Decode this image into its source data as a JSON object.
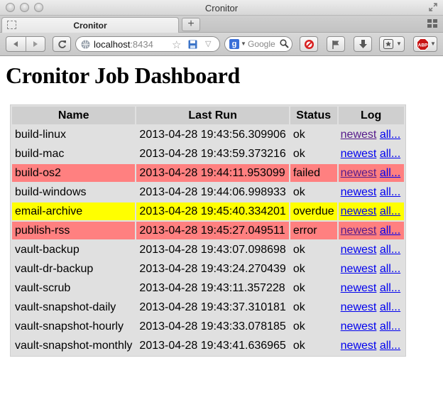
{
  "window": {
    "title": "Cronitor"
  },
  "tab": {
    "title": "Cronitor"
  },
  "toolbar": {
    "url_host": "localhost",
    "url_port": ":8434",
    "search_placeholder": "Google"
  },
  "page": {
    "title": "Cronitor Job Dashboard"
  },
  "table": {
    "headers": {
      "name": "Name",
      "last_run": "Last Run",
      "status": "Status",
      "log": "Log"
    },
    "rows": [
      {
        "name": "build-linux",
        "last_run": "2013-04-28 19:43:56.309906",
        "status": "ok",
        "newest": "newest",
        "all": "all..."
      },
      {
        "name": "build-mac",
        "last_run": "2013-04-28 19:43:59.373216",
        "status": "ok",
        "newest": "newest",
        "all": "all..."
      },
      {
        "name": "build-os2",
        "last_run": "2013-04-28 19:44:11.953099",
        "status": "failed",
        "newest": "newest",
        "all": "all..."
      },
      {
        "name": "build-windows",
        "last_run": "2013-04-28 19:44:06.998933",
        "status": "ok",
        "newest": "newest",
        "all": "all..."
      },
      {
        "name": "email-archive",
        "last_run": "2013-04-28 19:45:40.334201",
        "status": "overdue",
        "newest": "newest",
        "all": "all..."
      },
      {
        "name": "publish-rss",
        "last_run": "2013-04-28 19:45:27.049511",
        "status": "error",
        "newest": "newest",
        "all": "all..."
      },
      {
        "name": "vault-backup",
        "last_run": "2013-04-28 19:43:07.098698",
        "status": "ok",
        "newest": "newest",
        "all": "all..."
      },
      {
        "name": "vault-dr-backup",
        "last_run": "2013-04-28 19:43:24.270439",
        "status": "ok",
        "newest": "newest",
        "all": "all..."
      },
      {
        "name": "vault-scrub",
        "last_run": "2013-04-28 19:43:11.357228",
        "status": "ok",
        "newest": "newest",
        "all": "all..."
      },
      {
        "name": "vault-snapshot-daily",
        "last_run": "2013-04-28 19:43:37.310181",
        "status": "ok",
        "newest": "newest",
        "all": "all..."
      },
      {
        "name": "vault-snapshot-hourly",
        "last_run": "2013-04-28 19:43:33.078185",
        "status": "ok",
        "newest": "newest",
        "all": "all..."
      },
      {
        "name": "vault-snapshot-monthly",
        "last_run": "2013-04-28 19:43:41.636965",
        "status": "ok",
        "newest": "newest",
        "all": "all..."
      }
    ]
  },
  "colors": {
    "failed_row": "#ff8080",
    "overdue_row": "#ffff00",
    "cell_bg": "#e0e0e0",
    "header_bg": "#cfcfcf"
  },
  "icons": [
    "fullscreen-icon",
    "back-icon",
    "forward-icon",
    "reload-icon",
    "globe-icon",
    "star-icon",
    "save-icon",
    "google-icon",
    "search-icon",
    "stop-icon",
    "flag-icon",
    "download-icon",
    "bookmark-icon",
    "adblock-icon",
    "tabs-menu-icon"
  ]
}
